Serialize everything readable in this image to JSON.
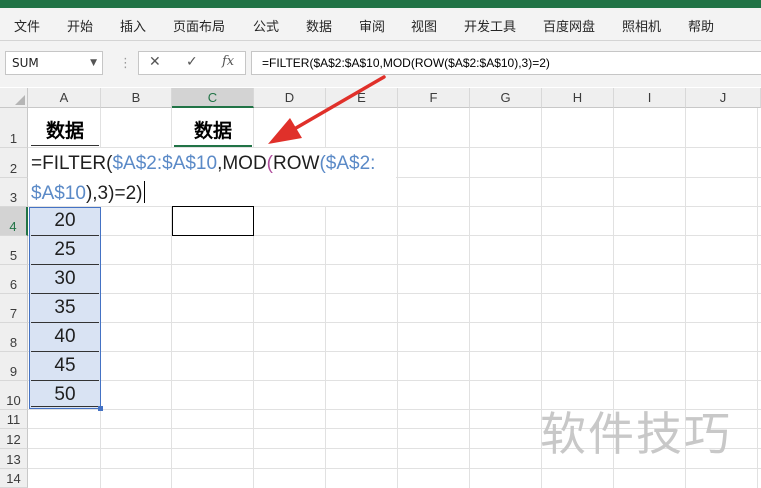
{
  "ribbon": {
    "tabs": [
      "文件",
      "开始",
      "插入",
      "页面布局",
      "公式",
      "数据",
      "审阅",
      "视图",
      "开发工具",
      "百度网盘",
      "照相机",
      "帮助"
    ]
  },
  "formula_bar": {
    "name_box": "SUM",
    "cancel_symbol": "✕",
    "enter_symbol": "✓",
    "fx_symbol": "fx",
    "formula": "=FILTER($A$2:$A$10,MOD(ROW($A$2:$A$10),3)=2)"
  },
  "columns": [
    "A",
    "B",
    "C",
    "D",
    "E",
    "F",
    "G",
    "H",
    "I",
    "J"
  ],
  "rows": [
    "1",
    "2",
    "3",
    "4",
    "5",
    "6",
    "7",
    "8",
    "9",
    "10",
    "11",
    "12",
    "13",
    "14"
  ],
  "cells": {
    "A1": "数据",
    "C1": "数据",
    "A4": "20",
    "A5": "25",
    "A6": "30",
    "A7": "35",
    "A8": "40",
    "A9": "45",
    "A10": "50"
  },
  "in_cell_edit": {
    "line1": {
      "p1": "=FILTER(",
      "r1": "$A$2:$A$10",
      "p2": ",MOD",
      "p3": "(",
      "p4": "ROW",
      "p5": "(",
      "r2": "$A$2:"
    },
    "line2": {
      "r1": "$A$10",
      "p1": "),3",
      "p2": ")=2)"
    }
  },
  "watermark": "软件技巧",
  "colors": {
    "excel_green": "#217346",
    "arrow_red": "#e0302a",
    "range_fill": "#d9e3f3",
    "ref_blue": "#5b8ac7"
  }
}
